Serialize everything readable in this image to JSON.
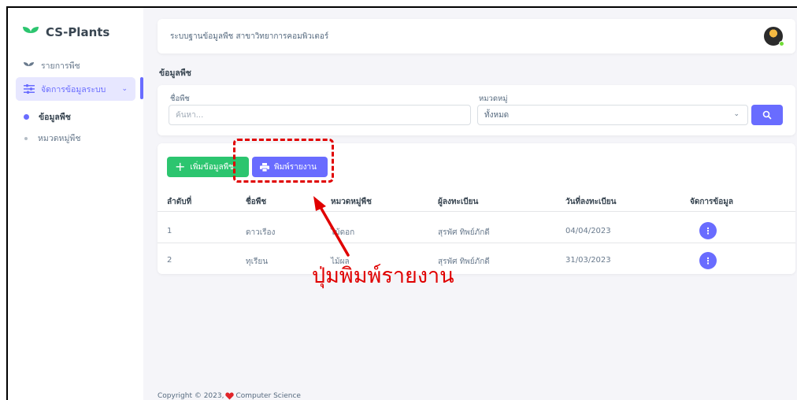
{
  "brand": {
    "name": "CS-Plants"
  },
  "sidebar": {
    "items": [
      {
        "label": "รายการพืช"
      },
      {
        "label": "จัดการข้อมูลระบบ"
      }
    ],
    "sub_items": [
      {
        "label": "ข้อมูลพืช"
      },
      {
        "label": "หมวดหมู่พืช"
      }
    ]
  },
  "navbar": {
    "title": "ระบบฐานข้อมูลพืช สาขาวิทยาการคอมพิวเตอร์"
  },
  "page": {
    "title": "ข้อมูลพืช"
  },
  "filter": {
    "name_label": "ชื่อพืช",
    "name_placeholder": "ค้นหา...",
    "category_label": "หมวดหมู่",
    "category_value": "ทั้งหมด"
  },
  "actions": {
    "add_label": "เพิ่มข้อมูลพืช",
    "print_label": "พิมพ์รายงาน"
  },
  "table": {
    "headers": [
      "ลำดับที่",
      "ชื่อพืช",
      "หมวดหมู่พืช",
      "ผู้ลงทะเบียน",
      "วันที่ลงทะเบียน",
      "จัดการข้อมูล"
    ],
    "rows": [
      {
        "no": "1",
        "name": "ดาวเรือง",
        "category": "ไม้ดอก",
        "registrar": "สุรพัศ ทิพย์ภักดี",
        "date": "04/04/2023"
      },
      {
        "no": "2",
        "name": "ทุเรียน",
        "category": "ไม้ผล",
        "registrar": "สุรพัศ ทิพย์ภักดี",
        "date": "31/03/2023"
      }
    ]
  },
  "footer": {
    "prefix": "Copyright © 2023,",
    "suffix": "Computer Science"
  },
  "annotation": {
    "text": "ปุ่มพิมพ์รายงาน"
  },
  "colors": {
    "primary": "#696cff",
    "success": "#2cc56f",
    "annotation": "#e00000",
    "heart": "#e1242a"
  }
}
